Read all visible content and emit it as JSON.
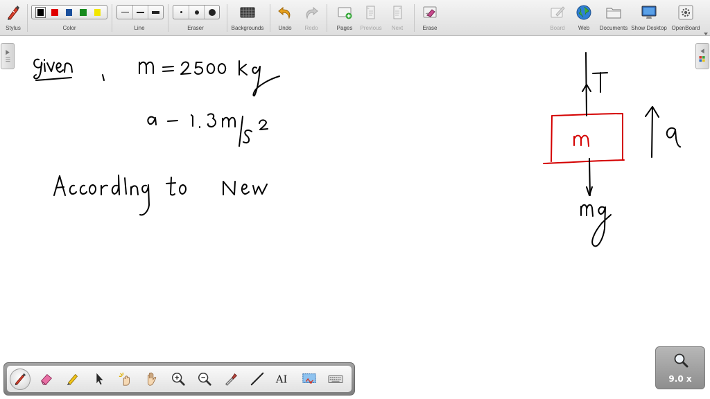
{
  "toolbar": {
    "stylus": "Stylus",
    "color": "Color",
    "line": "Line",
    "eraser": "Eraser",
    "backgrounds": "Backgrounds",
    "undo": "Undo",
    "redo": "Redo",
    "pages": "Pages",
    "previous": "Previous",
    "next": "Next",
    "erase": "Erase",
    "board": "Board",
    "web": "Web",
    "documents": "Documents",
    "show_desktop": "Show Desktop",
    "openboard": "OpenBoard"
  },
  "colors": {
    "palette": [
      "#000000",
      "#e00000",
      "#1a4f9c",
      "#178a1e",
      "#f2e600"
    ],
    "ink_black": "#000000",
    "ink_red": "#d40000"
  },
  "dock": {
    "tools": [
      "stylus-icon",
      "eraser-icon",
      "highlighter-icon",
      "pointer-icon",
      "laser-pointer-icon",
      "hand-icon",
      "zoom-in-icon",
      "zoom-out-icon",
      "pipette-icon",
      "line-icon",
      "text-icon",
      "capture-icon",
      "keyboard-icon"
    ],
    "text_tool_glyph": "AI"
  },
  "zoom": {
    "value": "9.0 x"
  }
}
